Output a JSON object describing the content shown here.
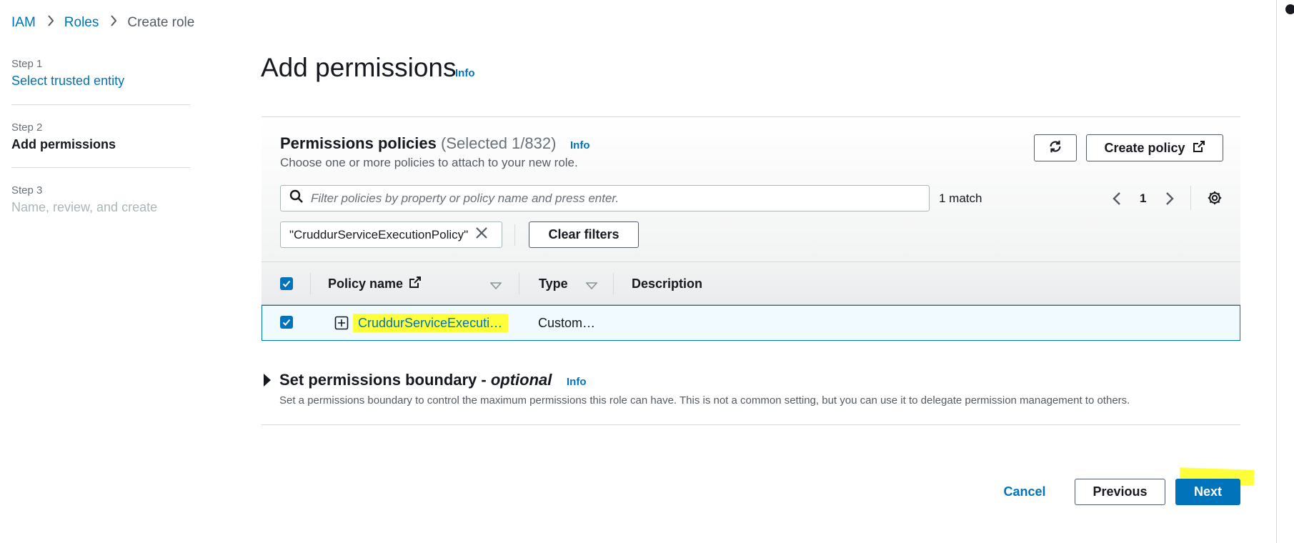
{
  "breadcrumb": {
    "items": [
      "IAM",
      "Roles",
      "Create role"
    ]
  },
  "steps": [
    {
      "label": "Step 1",
      "title": "Select trusted entity",
      "state": "link"
    },
    {
      "label": "Step 2",
      "title": "Add permissions",
      "state": "current"
    },
    {
      "label": "Step 3",
      "title": "Name, review, and create",
      "state": "disabled"
    }
  ],
  "page": {
    "title": "Add permissions",
    "info": "Info"
  },
  "policies": {
    "title": "Permissions policies",
    "count": "(Selected 1/832)",
    "info": "Info",
    "description": "Choose one or more policies to attach to your new role.",
    "create_policy_label": "Create policy",
    "search_placeholder": "Filter policies by property or policy name and press enter.",
    "match_text": "1 match",
    "page_number": "1",
    "filter_token": "\"CruddurServiceExecutionPolicy\"",
    "clear_filters_label": "Clear filters",
    "columns": [
      "Policy name",
      "Type",
      "Description"
    ],
    "rows": [
      {
        "name": "CruddurServiceExecuti…",
        "type": "Custom…",
        "description": "",
        "checked": true
      }
    ]
  },
  "boundary": {
    "title": "Set permissions boundary - ",
    "title_optional": "optional",
    "info": "Info",
    "description": "Set a permissions boundary to control the maximum permissions this role can have. This is not a common setting, but you can use it to delegate permission management to others."
  },
  "footer": {
    "cancel": "Cancel",
    "previous": "Previous",
    "next": "Next"
  },
  "colors": {
    "primary": "#0073bb",
    "highlight": "#ffff3a",
    "text": "#16191f",
    "muted": "#687078"
  }
}
